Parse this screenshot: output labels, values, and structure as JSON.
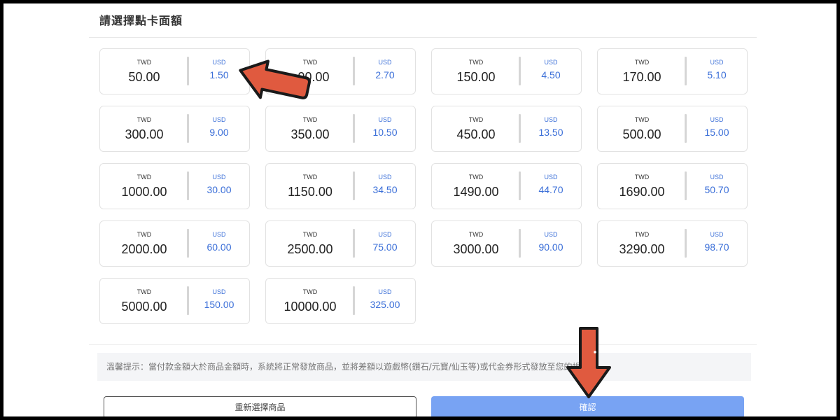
{
  "header": {
    "title": "請選擇點卡面額"
  },
  "cards": [
    {
      "left_currency": "TWD",
      "left_value": "50.00",
      "right_currency": "USD",
      "right_value": "1.50"
    },
    {
      "left_currency": "TWD",
      "left_value": ". 90.00",
      "right_currency": "USD",
      "right_value": "2.70"
    },
    {
      "left_currency": "TWD",
      "left_value": "150.00",
      "right_currency": "USD",
      "right_value": "4.50"
    },
    {
      "left_currency": "TWD",
      "left_value": "170.00",
      "right_currency": "USD",
      "right_value": "5.10"
    },
    {
      "left_currency": "TWD",
      "left_value": "300.00",
      "right_currency": "USD",
      "right_value": "9.00"
    },
    {
      "left_currency": "TWD",
      "left_value": "350.00",
      "right_currency": "USD",
      "right_value": "10.50"
    },
    {
      "left_currency": "TWD",
      "left_value": "450.00",
      "right_currency": "USD",
      "right_value": "13.50"
    },
    {
      "left_currency": "TWD",
      "left_value": "500.00",
      "right_currency": "USD",
      "right_value": "15.00"
    },
    {
      "left_currency": "TWD",
      "left_value": "1000.00",
      "right_currency": "USD",
      "right_value": "30.00"
    },
    {
      "left_currency": "TWD",
      "left_value": "1150.00",
      "right_currency": "USD",
      "right_value": "34.50"
    },
    {
      "left_currency": "TWD",
      "left_value": "1490.00",
      "right_currency": "USD",
      "right_value": "44.70"
    },
    {
      "left_currency": "TWD",
      "left_value": "1690.00",
      "right_currency": "USD",
      "right_value": "50.70"
    },
    {
      "left_currency": "TWD",
      "left_value": "2000.00",
      "right_currency": "USD",
      "right_value": "60.00"
    },
    {
      "left_currency": "TWD",
      "left_value": "2500.00",
      "right_currency": "USD",
      "right_value": "75.00"
    },
    {
      "left_currency": "TWD",
      "left_value": "3000.00",
      "right_currency": "USD",
      "right_value": "90.00"
    },
    {
      "left_currency": "TWD",
      "left_value": "3290.00",
      "right_currency": "USD",
      "right_value": "98.70"
    },
    {
      "left_currency": "TWD",
      "left_value": "5000.00",
      "right_currency": "USD",
      "right_value": "150.00"
    },
    {
      "left_currency": "TWD",
      "left_value": "10000.00",
      "right_currency": "USD",
      "right_value": "325.00"
    }
  ],
  "notice": {
    "text": "溫馨提示：當付款金額大於商品金額時，系統將正常發放商品，並將差額以遊戲幣(鑽石/元寶/仙玉等)或代金券形式發放至您的帳戶"
  },
  "buttons": {
    "reset_label": "重新選擇商品",
    "confirm_label": "確認"
  },
  "colors": {
    "accent": "#3b6fd8",
    "confirm_bg": "#78a3f3",
    "arrow_fill": "#e05a3f"
  },
  "overlay_icons": [
    "arrow-left-icon",
    "arrow-down-icon"
  ]
}
